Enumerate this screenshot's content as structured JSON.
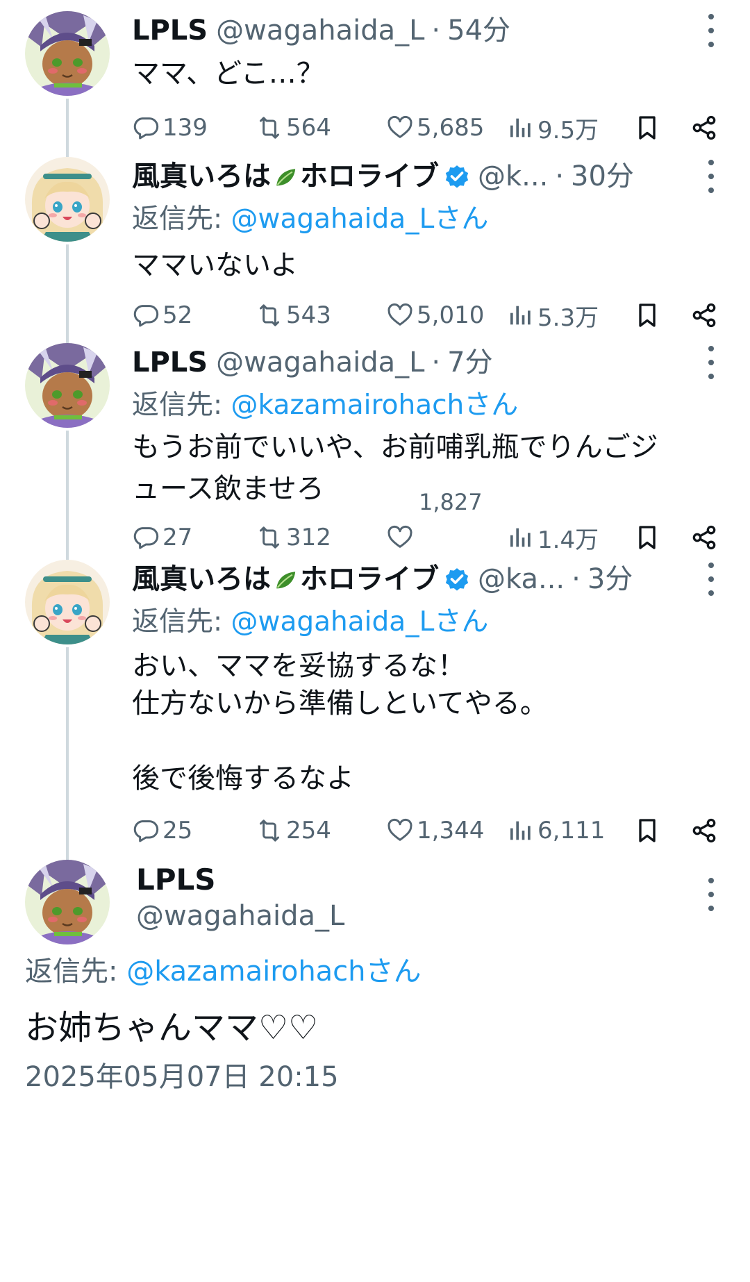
{
  "tweets": [
    {
      "name": "LPLS",
      "handle": "@wagahaida_L",
      "dot": "·",
      "time": "54分",
      "text": "ママ、どこ…？",
      "replies": "139",
      "retweets": "564",
      "likes": "5,685",
      "views": "9.5万"
    },
    {
      "name_a": "風真いろは",
      "name_b": "ホロライブ",
      "handle": "@k...",
      "dot": "·",
      "time": "30分",
      "reply_prefix": "返信先: ",
      "reply_mention": "@wagahaida_Lさん",
      "text": "ママいないよ",
      "replies": "52",
      "retweets": "543",
      "likes": "5,010",
      "views": "5.3万"
    },
    {
      "name": "LPLS",
      "handle": "@wagahaida_L",
      "dot": "·",
      "time": "7分",
      "reply_prefix": "返信先: ",
      "reply_mention": "@kazamairohachさん",
      "text": "もうお前でいいや、お前哺乳瓶でりんごジ\nュース飲ませろ",
      "replies": "27",
      "retweets": "312",
      "likes": "1,827",
      "views": "1.4万"
    },
    {
      "name_a": "風真いろは",
      "name_b": "ホロライブ",
      "handle": "@ka...",
      "dot": "·",
      "time": "3分",
      "reply_prefix": "返信先: ",
      "reply_mention": "@wagahaida_Lさん",
      "text": "おい、ママを妥協するな！\n仕方ないから準備しといてやる。\n\n後で後悔するなよ",
      "replies": "25",
      "retweets": "254",
      "likes": "1,344",
      "views": "6,111"
    }
  ],
  "main": {
    "name": "LPLS",
    "handle": "@wagahaida_L",
    "reply_prefix": "返信先: ",
    "reply_mention": "@kazamairohachさん",
    "text": "お姉ちゃんママ♡♡",
    "datetime": "2025年05月07日 20:15"
  },
  "colors": {
    "text": "#0f1419",
    "secondary": "#536471",
    "link": "#1d9bf0",
    "verified": "#1d9bf0",
    "thread_line": "#cfd9de"
  },
  "icons": [
    "reply-icon",
    "retweet-icon",
    "like-icon",
    "views-icon",
    "bookmark-icon",
    "share-icon",
    "more-icon",
    "verified-badge-icon",
    "leaf-icon"
  ]
}
